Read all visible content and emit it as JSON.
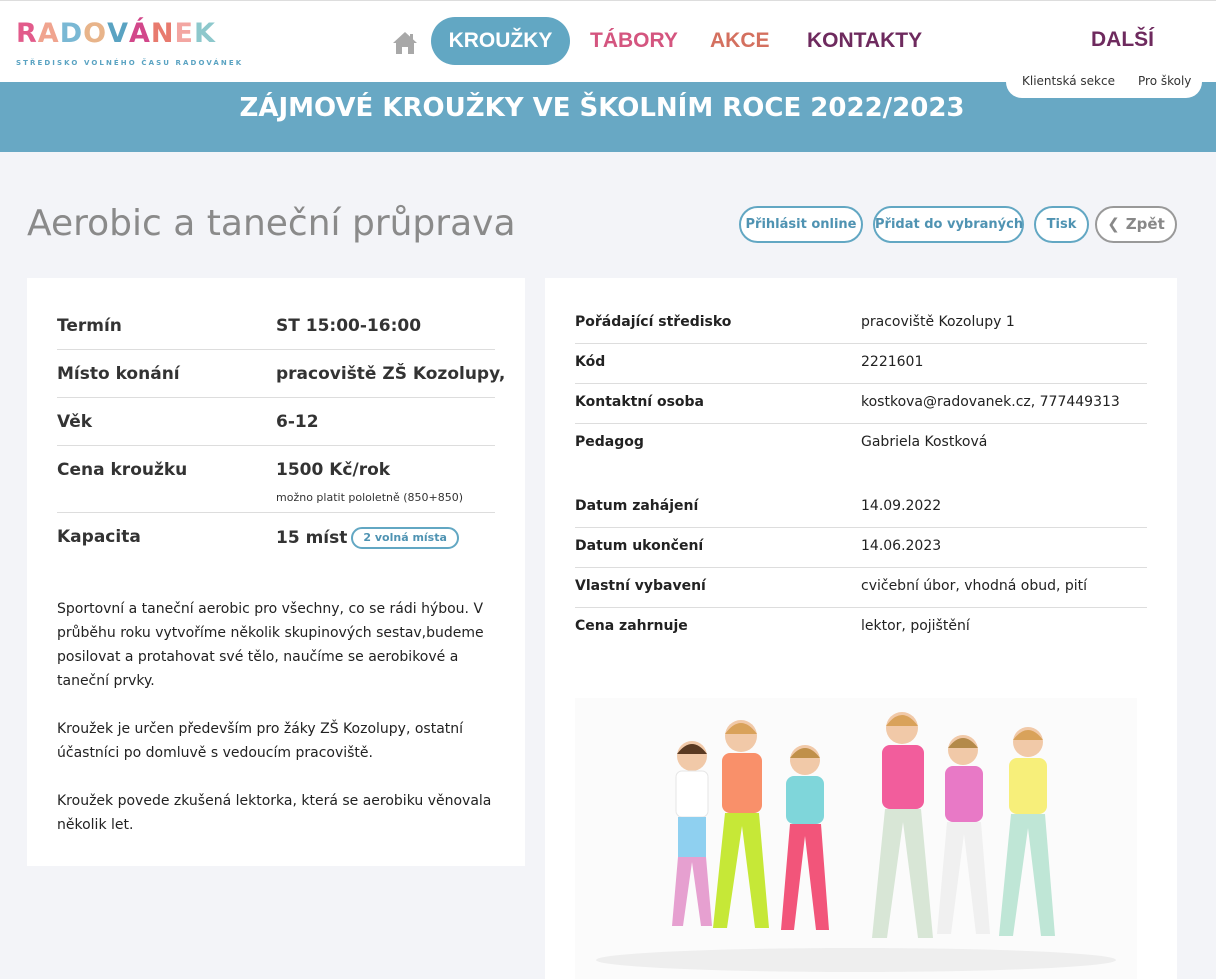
{
  "header": {
    "logo": {
      "letters": [
        "R",
        "A",
        "D",
        "O",
        "V",
        "Á",
        "N",
        "E",
        "K"
      ],
      "colors": [
        "#e25b8b",
        "#f0a48f",
        "#7ab8d4",
        "#e8b48a",
        "#5aa3c2",
        "#d2478a",
        "#e87a6e",
        "#f3a6a2",
        "#8dc8cc"
      ],
      "subtitle": "STŘEDISKO VOLNÉHO ČASU RADOVÁNEK"
    },
    "nav": {
      "krouzky": "KROUŽKY",
      "tabory": "TÁBORY",
      "akce": "AKCE",
      "kontakty": "KONTAKTY",
      "dalsi": "DALŠÍ"
    },
    "links": {
      "klientska": "Klientská sekce",
      "skoly": "Pro školy"
    }
  },
  "banner": {
    "title": "ZÁJMOVÉ KROUŽKY VE ŠKOLNÍM ROCE 2022/2023"
  },
  "course": {
    "title": "Aerobic a taneční průprava"
  },
  "actions": {
    "online": "Přihlásit online",
    "add": "Přidat do vybraných",
    "print": "Tisk",
    "back": "Zpět"
  },
  "left": {
    "rows": [
      {
        "key": "Termín",
        "value": "ST 15:00-16:00"
      },
      {
        "key": "Místo konání",
        "value": "pracoviště ZŠ Kozolupy,"
      },
      {
        "key": "Věk",
        "value": "6-12"
      },
      {
        "key": "Cena kroužku",
        "value": "1500 Kč/rok",
        "note": "možno platit pololetně (850+850)"
      },
      {
        "key": "Kapacita",
        "value": "15 míst",
        "badge": "2 volná místa"
      }
    ],
    "description": [
      "Sportovní a taneční aerobic pro všechny, co se rádi hýbou. V průběhu roku vytvoříme několik skupinových sestav,budeme posilovat a protahovat své tělo, naučíme se aerobikové a taneční prvky.",
      "Kroužek je určen především pro žáky ZŠ Kozolupy, ostatní účastníci po domluvě s vedoucím pracoviště.",
      "Kroužek povede zkušená lektorka, která se aerobiku věnovala několik let."
    ]
  },
  "right": {
    "rows": [
      {
        "key": "Pořádající středisko",
        "value": "pracoviště Kozolupy 1"
      },
      {
        "key": "Kód",
        "value": "2221601"
      },
      {
        "key": "Kontaktní osoba",
        "value": "kostkova@radovanek.cz, 777449313"
      },
      {
        "key": "Pedagog",
        "value": "Gabriela Kostková"
      },
      {
        "key": "Datum zahájení",
        "value": "14.09.2022"
      },
      {
        "key": "Datum ukončení",
        "value": "14.06.2023"
      },
      {
        "key": "Vlastní vybavení",
        "value": "cvičební úbor, vhodná obud, pití"
      },
      {
        "key": "Cena zahrnuje",
        "value": "lektor, pojištění"
      }
    ]
  },
  "colors": {
    "accent": "#62a7c3",
    "banner": "#68a8c4",
    "tabory": "#d4557f",
    "akce": "#d4705f",
    "kontakty": "#6e2a5e"
  }
}
